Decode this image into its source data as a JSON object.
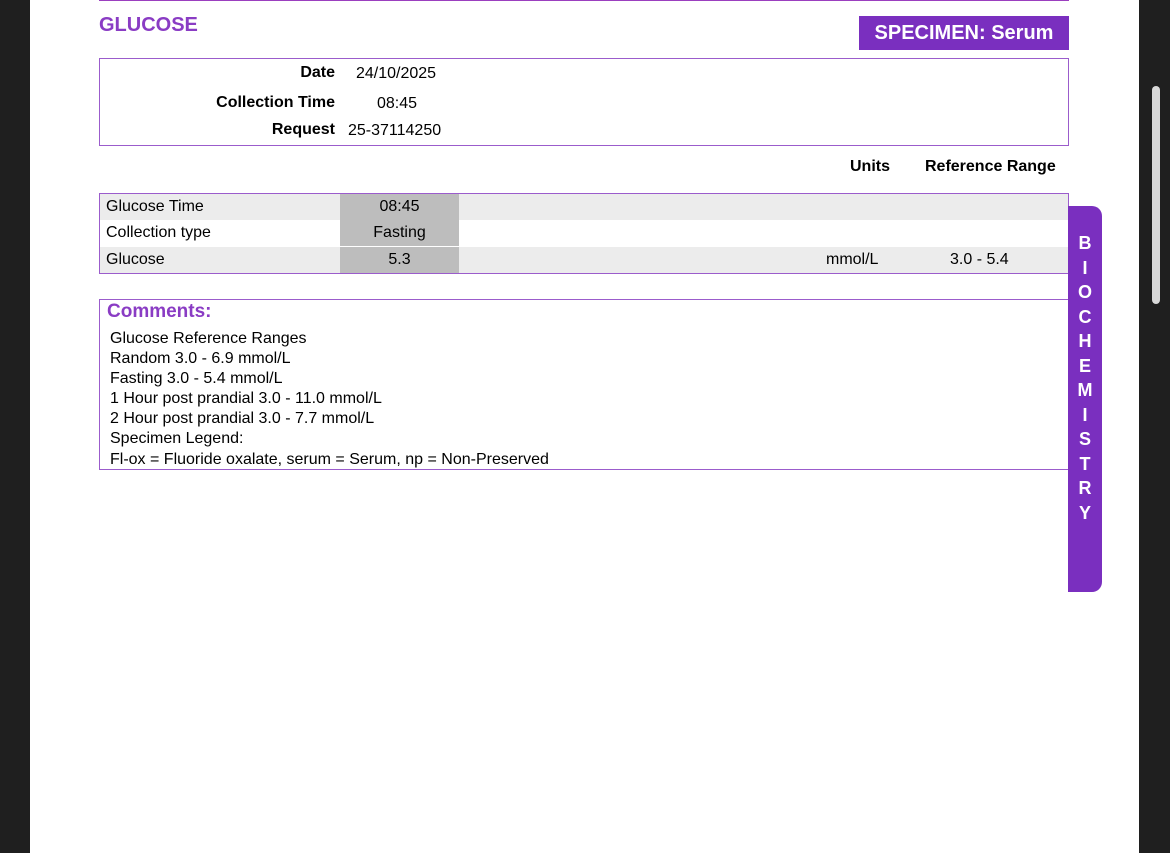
{
  "report": {
    "title": "GLUCOSE",
    "specimen": "SPECIMEN: Serum",
    "info": {
      "date_label": "Date",
      "date_value": "24/10/2025",
      "collection_label": "Collection Time",
      "collection_value": "08:45",
      "request_label": "Request",
      "request_value": "25-37114250"
    },
    "columns": {
      "units": "Units",
      "reference": "Reference Range"
    },
    "results": [
      {
        "name": "Glucose Time",
        "value": "08:45",
        "unit": "",
        "range": ""
      },
      {
        "name": "Collection type",
        "value": "Fasting",
        "unit": "",
        "range": ""
      },
      {
        "name": "Glucose",
        "value": "5.3",
        "unit": "mmol/L",
        "range": "3.0 - 5.4"
      }
    ],
    "comments": {
      "title": "Comments:",
      "lines": [
        "Glucose Reference Ranges",
        "Random 3.0 - 6.9 mmol/L",
        "Fasting 3.0 - 5.4 mmol/L",
        "1 Hour post prandial 3.0 - 11.0 mmol/L",
        "2 Hour post prandial 3.0 - 7.7 mmol/L",
        "Specimen Legend:",
        "Fl-ox = Fluoride oxalate, serum = Serum, np = Non-Preserved"
      ]
    },
    "side_tab": [
      "B",
      "I",
      "O",
      "C",
      "H",
      "E",
      "M",
      "I",
      "S",
      "T",
      "R",
      "Y"
    ]
  },
  "colors": {
    "accent": "#7a2fbf",
    "title": "#8a3cc4",
    "border": "#9b5ccc",
    "value_cell": "#bdbdbd",
    "row_shade": "#ececec"
  }
}
